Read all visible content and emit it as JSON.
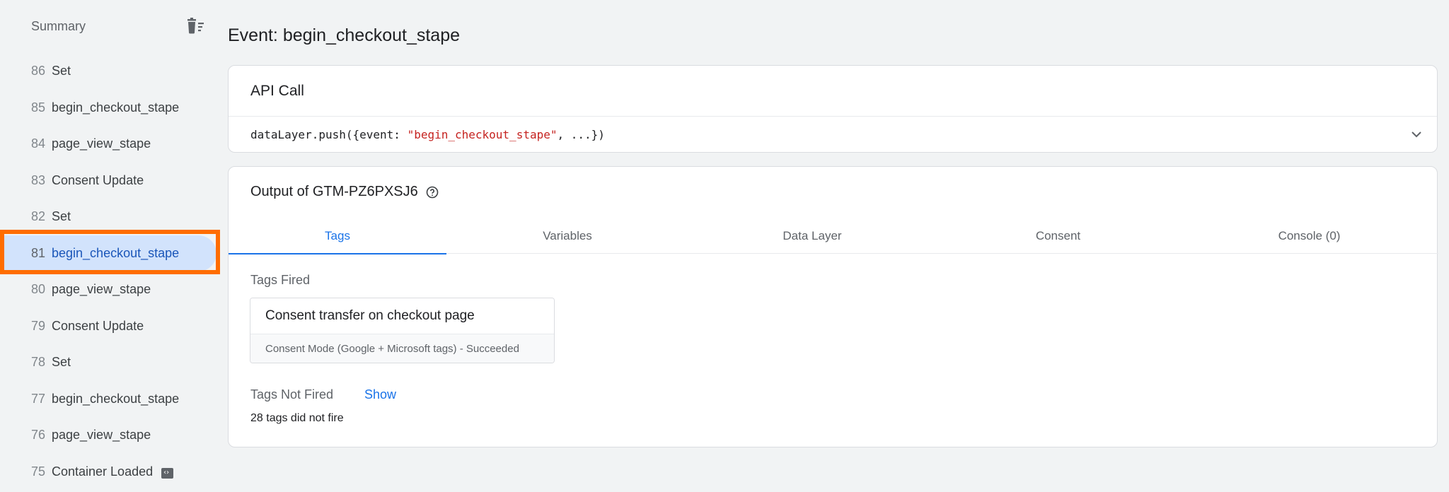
{
  "sidebar": {
    "title": "Summary",
    "clear_icon": "delete-sweep-icon",
    "events": [
      {
        "num": "86",
        "label": "Set"
      },
      {
        "num": "85",
        "label": "begin_checkout_stape"
      },
      {
        "num": "84",
        "label": "page_view_stape"
      },
      {
        "num": "83",
        "label": "Consent Update"
      },
      {
        "num": "82",
        "label": "Set"
      },
      {
        "num": "81",
        "label": "begin_checkout_stape",
        "selected": true
      },
      {
        "num": "80",
        "label": "page_view_stape"
      },
      {
        "num": "79",
        "label": "Consent Update"
      },
      {
        "num": "78",
        "label": "Set"
      },
      {
        "num": "77",
        "label": "begin_checkout_stape"
      },
      {
        "num": "76",
        "label": "page_view_stape"
      },
      {
        "num": "75",
        "label": "Container Loaded",
        "icon": "container-icon"
      }
    ]
  },
  "main": {
    "title": "Event: begin_checkout_stape",
    "api_call": {
      "heading": "API Call",
      "code_prefix": "dataLayer.push({event: ",
      "code_string": "\"begin_checkout_stape\"",
      "code_suffix": ", ...})"
    },
    "output": {
      "heading": "Output of GTM-PZ6PXSJ6",
      "tabs": [
        {
          "label": "Tags",
          "active": true
        },
        {
          "label": "Variables"
        },
        {
          "label": "Data Layer"
        },
        {
          "label": "Consent"
        },
        {
          "label": "Console (0)"
        }
      ],
      "tags_fired_label": "Tags Fired",
      "fired_tag": {
        "name": "Consent transfer on checkout page",
        "status": "Consent Mode (Google + Microsoft tags) - Succeeded"
      },
      "tags_not_fired_label": "Tags Not Fired",
      "show_label": "Show",
      "not_fired_count": "28 tags did not fire"
    }
  },
  "colors": {
    "accent": "#1a73e8",
    "selected_bg": "#d2e3fc",
    "highlight": "#ff6d00",
    "code_string": "#c5221f"
  }
}
